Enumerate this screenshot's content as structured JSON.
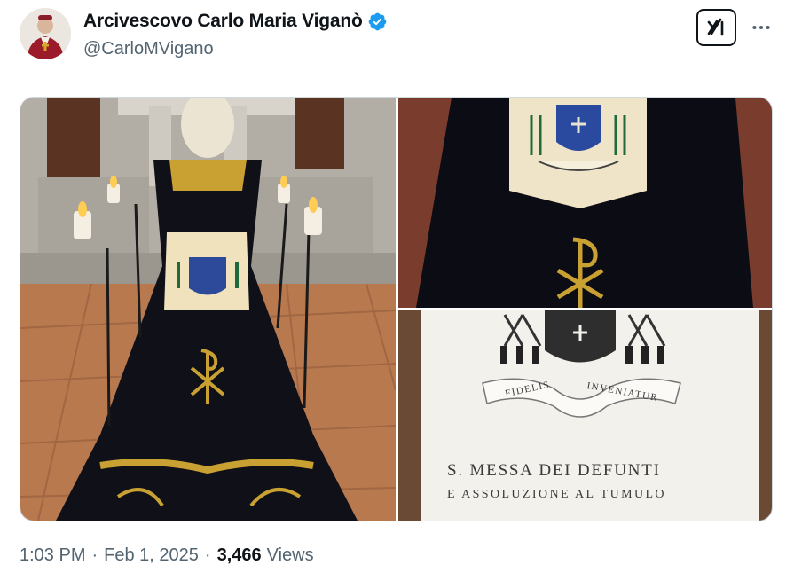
{
  "author": {
    "display_name": "Arcivescovo Carlo Maria Viganò",
    "handle": "@CarloMVigano",
    "verified": true,
    "avatar_icon": "avatar-bishop-portrait"
  },
  "header_actions": {
    "grok_icon": "grok-icon",
    "more_icon": "more-horizontal-icon"
  },
  "media": {
    "items": [
      {
        "icon": "photo-catafalque-with-candles"
      },
      {
        "icon": "photo-pall-closeup-coat-of-arms"
      },
      {
        "icon": "photo-booklet-cover"
      }
    ],
    "booklet": {
      "motto_left": "FIDELIS",
      "motto_right": "INVENIATUR",
      "title": "S. MESSA DEI DEFUNTI",
      "subtitle": "E ASSOLUZIONE AL TUMULO"
    }
  },
  "meta": {
    "time": "1:03 PM",
    "separator": "·",
    "date": "Feb 1, 2025",
    "views_count": "3,466",
    "views_label": "Views"
  },
  "colors": {
    "verified_blue": "#1d9bf0",
    "text_primary": "#0f1419",
    "text_secondary": "#536471",
    "border": "#cfd9de"
  }
}
